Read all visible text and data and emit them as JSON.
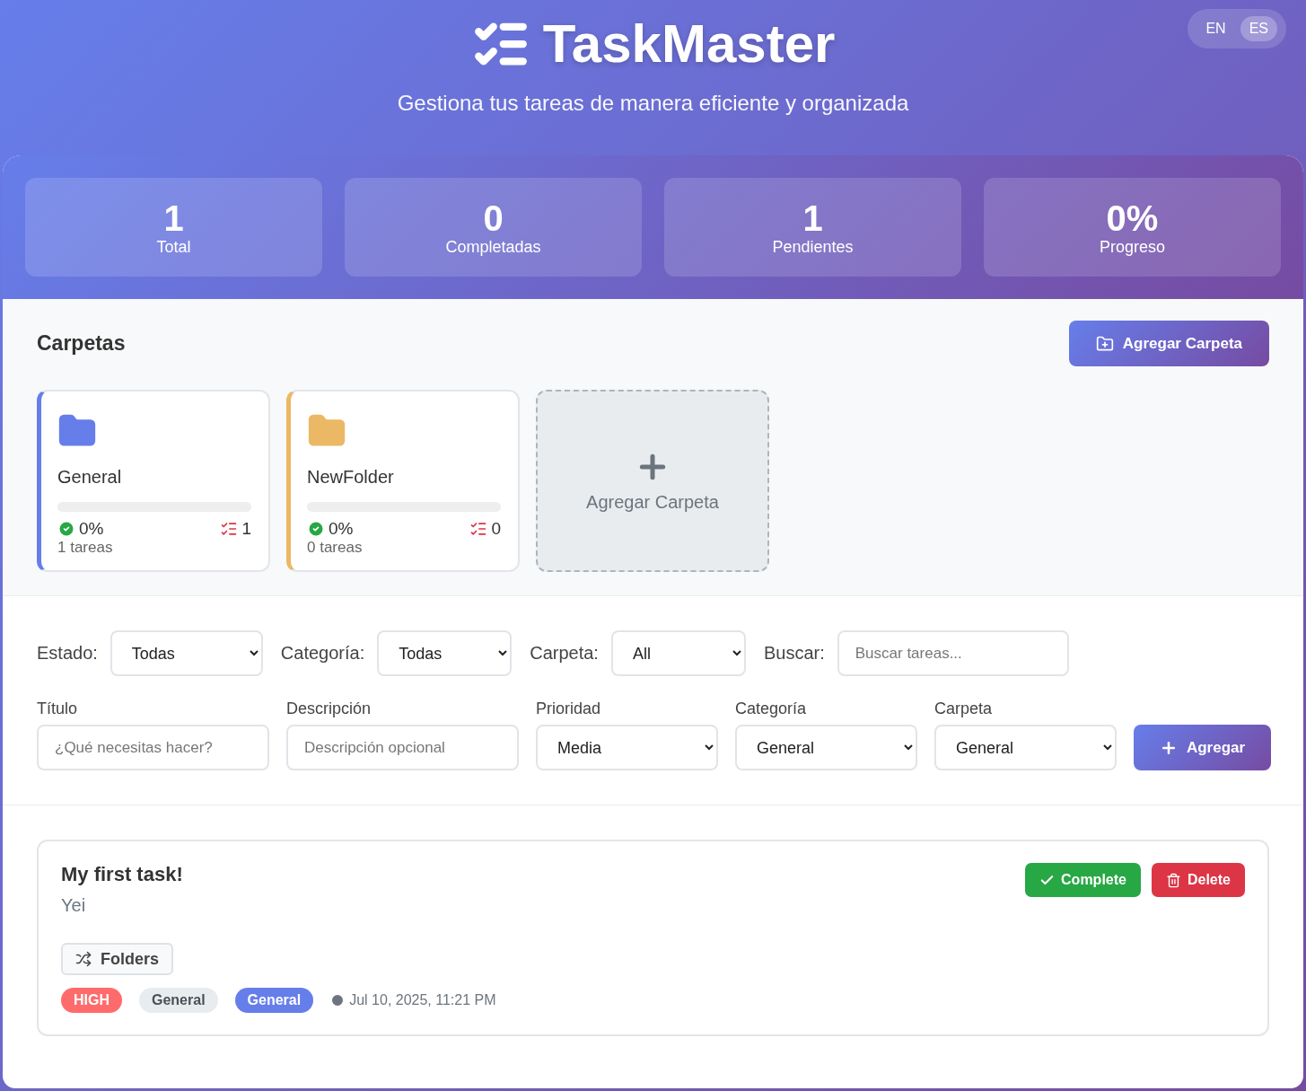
{
  "language_switch": [
    {
      "label": "EN",
      "selected": false
    },
    {
      "label": "ES",
      "selected": true
    }
  ],
  "header": {
    "title": "TaskMaster",
    "subtitle": "Gestiona tus tareas de manera eficiente y organizada"
  },
  "stats": [
    {
      "value": "1",
      "label": "Total"
    },
    {
      "value": "0",
      "label": "Completadas"
    },
    {
      "value": "1",
      "label": "Pendientes"
    },
    {
      "value": "0%",
      "label": "Progreso"
    }
  ],
  "folders": {
    "title": "Carpetas",
    "add_button": "Agregar Carpeta",
    "add_tile": "Agregar Carpeta",
    "items": [
      {
        "name": "General",
        "color": "#667eea",
        "level": 0,
        "percent": "0%",
        "count": "1",
        "tasks": "1 tareas"
      },
      {
        "name": "NewFolder",
        "color": "#ebb865",
        "level": 0,
        "percent": "0%",
        "count": "0",
        "tasks": "0 tareas"
      }
    ]
  },
  "filters": [
    {
      "kind": "select",
      "label": "Estado:",
      "value": "Todas"
    },
    {
      "kind": "select",
      "label": "Categoría:",
      "value": "Todas"
    },
    {
      "kind": "select",
      "label": "Carpeta:",
      "value": "All"
    },
    {
      "kind": "input",
      "label": "Buscar:",
      "placeholder": "Buscar tareas..."
    }
  ],
  "form": {
    "fields": [
      {
        "kind": "input",
        "label": "Título",
        "placeholder": "¿Qué necesitas hacer?"
      },
      {
        "kind": "input",
        "label": "Descripción",
        "placeholder": "Descripción opcional"
      },
      {
        "kind": "select",
        "label": "Prioridad",
        "value": "Media"
      },
      {
        "kind": "select",
        "label": "Categoría",
        "value": "General"
      },
      {
        "kind": "select",
        "label": "Carpeta",
        "value": "General"
      }
    ],
    "submit": "Agregar"
  },
  "tasks": [
    {
      "title": "My first task!",
      "description": "Yei",
      "complete": "Complete",
      "delete": "Delete",
      "folders_button": "Folders",
      "tags": [
        {
          "label": "HIGH",
          "kind": "priority"
        },
        {
          "label": "General",
          "kind": "category"
        },
        {
          "label": "General",
          "kind": "folder"
        }
      ],
      "date": "Jul 10, 2025, 11:21 PM"
    }
  ]
}
